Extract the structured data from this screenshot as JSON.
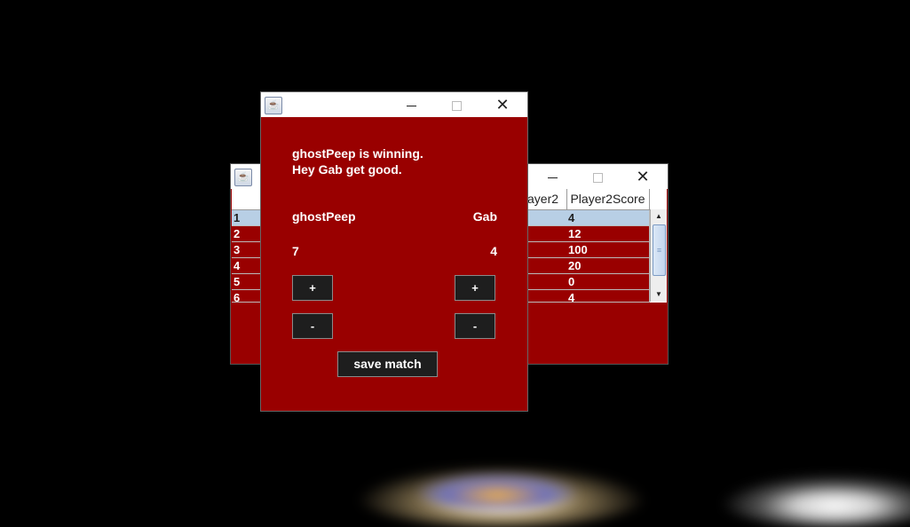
{
  "back_window": {
    "title_icon": "java-icon",
    "headers": [
      "ayer2",
      "Player2Score"
    ],
    "rows": [
      {
        "id": "1",
        "score": "4",
        "selected": true
      },
      {
        "id": "2",
        "score": "12",
        "selected": false
      },
      {
        "id": "3",
        "score": "100",
        "selected": false
      },
      {
        "id": "4",
        "score": "20",
        "selected": false
      },
      {
        "id": "5",
        "score": "0",
        "selected": false
      },
      {
        "id": "6",
        "score": "4",
        "selected": false
      }
    ]
  },
  "dialog": {
    "title_icon": "java-icon",
    "message_line1": "ghostPeep is winning.",
    "message_line2": "Hey Gab get good.",
    "player1_name": "ghostPeep",
    "player2_name": "Gab",
    "player1_score": "7",
    "player2_score": "4",
    "plus_label": "+",
    "minus_label": "-",
    "save_label": "save match"
  },
  "colors": {
    "window_bg": "#990000",
    "button_bg": "#1e1e1e",
    "selection": "#b8cfe5"
  }
}
